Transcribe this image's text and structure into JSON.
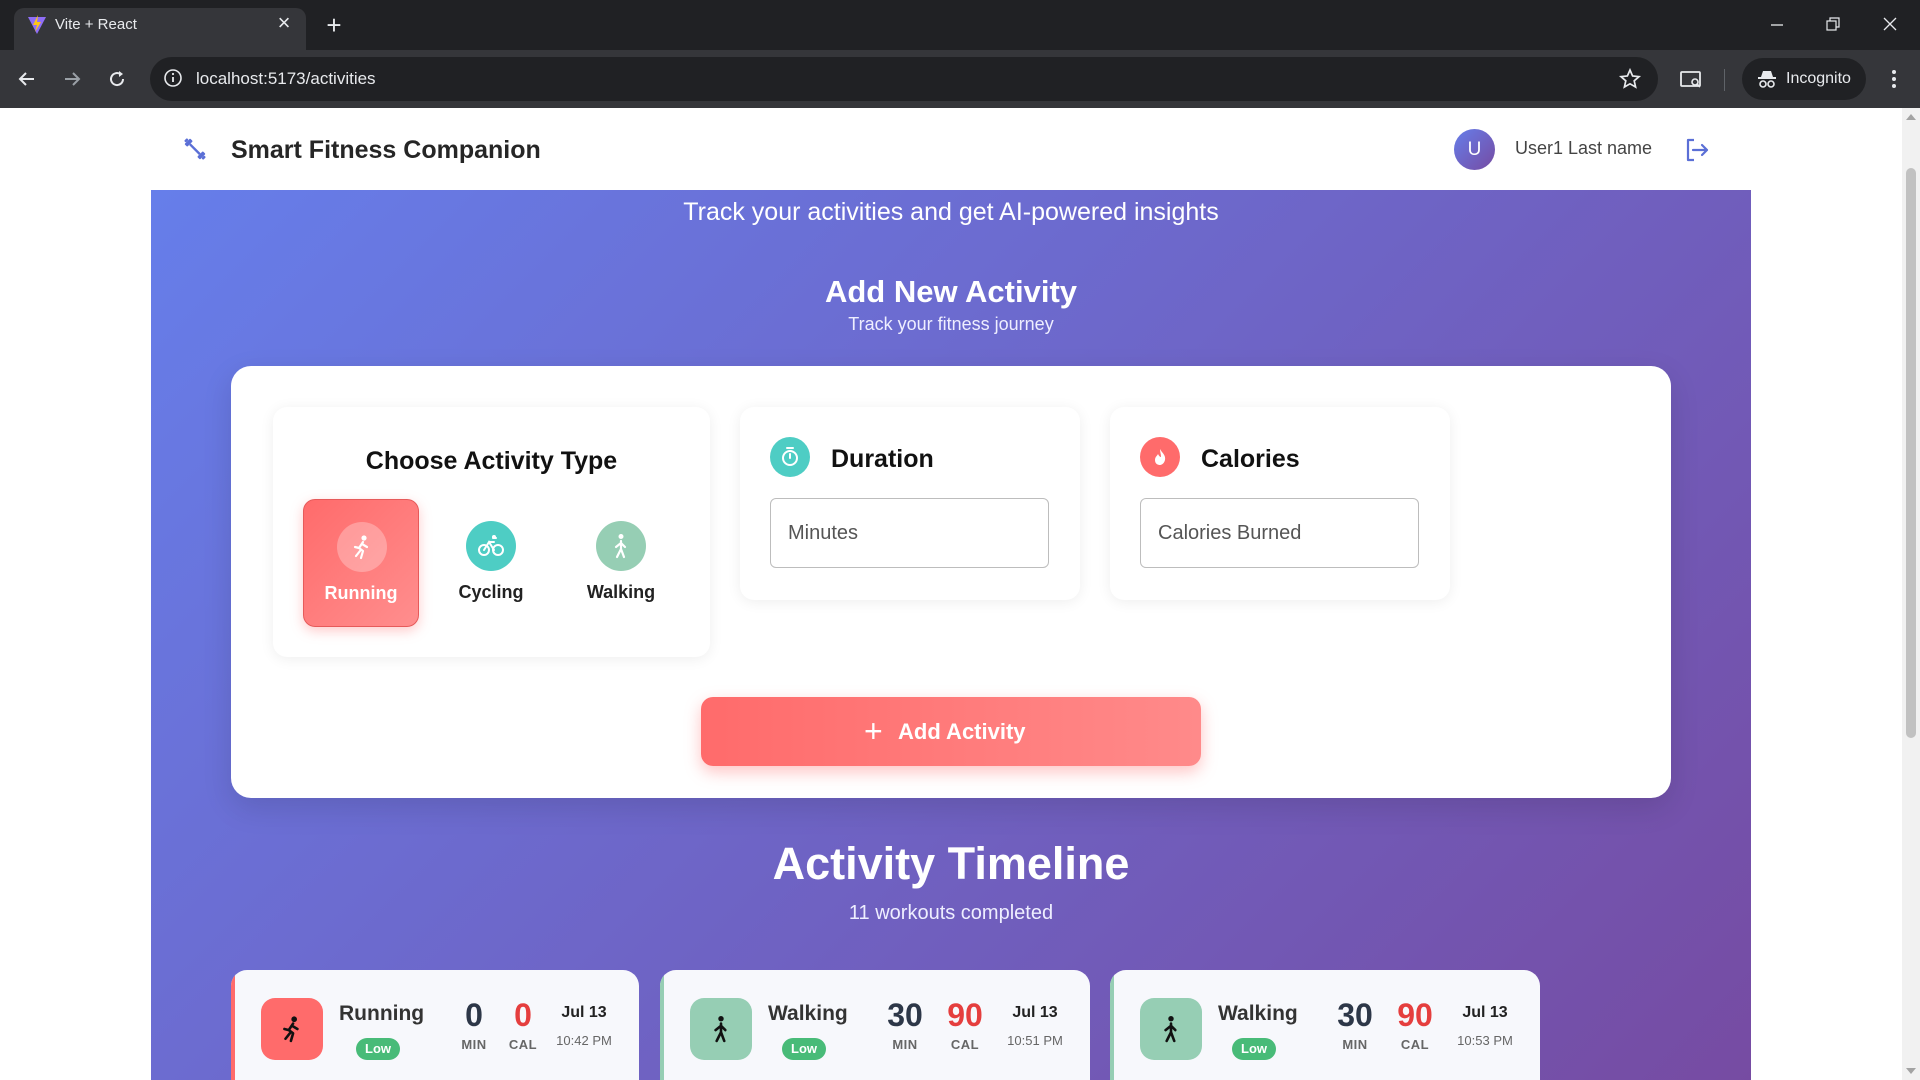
{
  "browser": {
    "tab_title": "Vite + React",
    "url": "localhost:5173/activities",
    "profile_label": "Incognito"
  },
  "app": {
    "title": "Smart Fitness Companion",
    "user_initial": "U",
    "user_name": "User1 Last name",
    "tagline": "Track your activities and get AI-powered insights"
  },
  "form": {
    "title": "Add New Activity",
    "subtitle": "Track your fitness journey",
    "type_panel_title": "Choose Activity Type",
    "types": [
      {
        "label": "Running",
        "selected": true
      },
      {
        "label": "Cycling",
        "selected": false
      },
      {
        "label": "Walking",
        "selected": false
      }
    ],
    "duration": {
      "title": "Duration",
      "placeholder": "Minutes",
      "value": ""
    },
    "calories": {
      "title": "Calories",
      "placeholder": "Calories Burned",
      "value": ""
    },
    "submit_label": "Add Activity"
  },
  "timeline": {
    "title": "Activity Timeline",
    "subtitle": "11 workouts completed",
    "activities": [
      {
        "type": "Running",
        "intensity": "Low",
        "duration": "0",
        "duration_unit": "MIN",
        "calories": "0",
        "calories_unit": "CAL",
        "date": "Jul 13",
        "time": "10:42 PM"
      },
      {
        "type": "Walking",
        "intensity": "Low",
        "duration": "30",
        "duration_unit": "MIN",
        "calories": "90",
        "calories_unit": "CAL",
        "date": "Jul 13",
        "time": "10:51 PM"
      },
      {
        "type": "Walking",
        "intensity": "Low",
        "duration": "30",
        "duration_unit": "MIN",
        "calories": "90",
        "calories_unit": "CAL",
        "date": "Jul 13",
        "time": "10:53 PM"
      }
    ]
  },
  "colors": {
    "hero_start": "#667eea",
    "hero_end": "#764ba2",
    "running": "#ff6b6b",
    "cycling": "#4ecdc4",
    "walking": "#96ceb4",
    "badge_low": "#48bb78",
    "duration_value": "#2d3748",
    "calories_value": "#e53e3e",
    "logo": "#5b6fd6"
  },
  "icons": {
    "logo": "dumbbell-icon",
    "logout": "logout-icon",
    "duration": "timer-icon",
    "calories": "flame-icon",
    "running": "running-icon",
    "cycling": "bike-icon",
    "walking": "walking-icon",
    "add": "plus-icon"
  }
}
